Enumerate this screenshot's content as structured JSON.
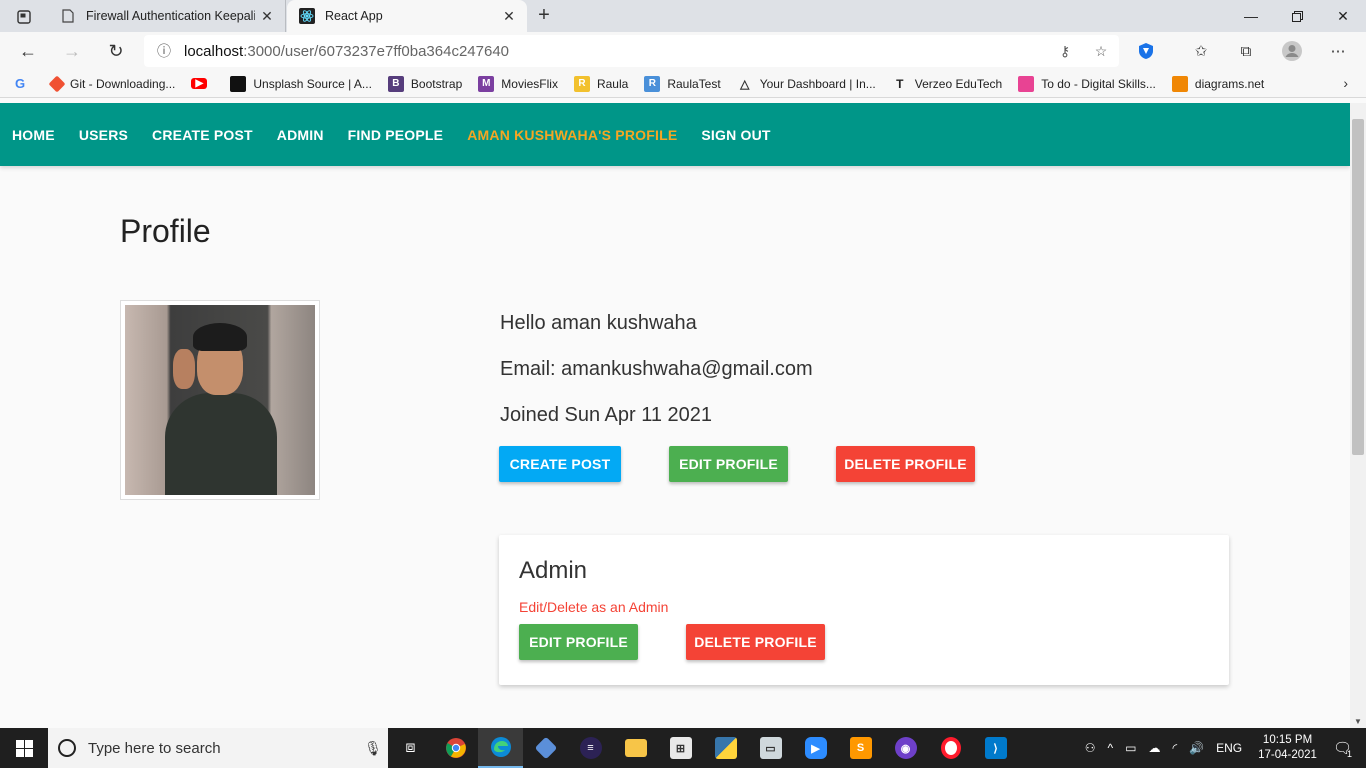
{
  "browser": {
    "tabs": [
      {
        "title": "Firewall Authentication Keepalive",
        "active": false
      },
      {
        "title": "React App",
        "active": true
      }
    ],
    "address": {
      "host": "localhost",
      "path": ":3000/user/6073237e7ff0ba364c247640"
    },
    "bookmarks": [
      {
        "label": "Git - Downloading...",
        "icon": "git-icon",
        "color": "#f05133"
      },
      {
        "label": "",
        "icon": "youtube-icon",
        "color": "#ff0000"
      },
      {
        "label": "Unsplash Source | A...",
        "icon": "unsplash-icon",
        "color": "#111111"
      },
      {
        "label": "Bootstrap",
        "icon": "bootstrap-icon",
        "color": "#563d7c"
      },
      {
        "label": "MoviesFlix",
        "icon": "moviesflix-icon",
        "color": "#7b3fa0"
      },
      {
        "label": "Raula",
        "icon": "raula-icon",
        "color": "#f2c12e"
      },
      {
        "label": "RaulaTest",
        "icon": "raulatest-icon",
        "color": "#4a90d9"
      },
      {
        "label": "Your Dashboard | In...",
        "icon": "dashboard-icon",
        "color": "#333333"
      },
      {
        "label": "Verzeo EduTech",
        "icon": "verzeo-icon",
        "color": "#222222"
      },
      {
        "label": "To do - Digital Skills...",
        "icon": "todo-icon",
        "color": "#e84393"
      },
      {
        "label": "diagrams.net",
        "icon": "diagrams-icon",
        "color": "#f08705"
      }
    ]
  },
  "nav": {
    "home": "HOME",
    "users": "USERS",
    "create_post": "CREATE POST",
    "admin": "ADMIN",
    "find_people": "FIND PEOPLE",
    "profile": "AMAN KUSHWAHA'S PROFILE",
    "sign_out": "SIGN OUT",
    "active_color": "#f5a623",
    "bar_color": "#009688"
  },
  "profile": {
    "heading": "Profile",
    "hello": "Hello aman kushwaha",
    "email": "Email: amankushwaha@gmail.com",
    "joined": "Joined Sun Apr 11 2021",
    "buttons": {
      "create_post": "CREATE POST",
      "edit_profile": "EDIT PROFILE",
      "delete_profile": "DELETE PROFILE"
    }
  },
  "admin_card": {
    "title": "Admin",
    "subtitle": "Edit/Delete as an Admin",
    "edit": "EDIT PROFILE",
    "delete": "DELETE PROFILE"
  },
  "taskbar": {
    "search_placeholder": "Type here to search",
    "lang": "ENG",
    "time": "10:15 PM",
    "date": "17-04-2021",
    "notifications": "1"
  }
}
